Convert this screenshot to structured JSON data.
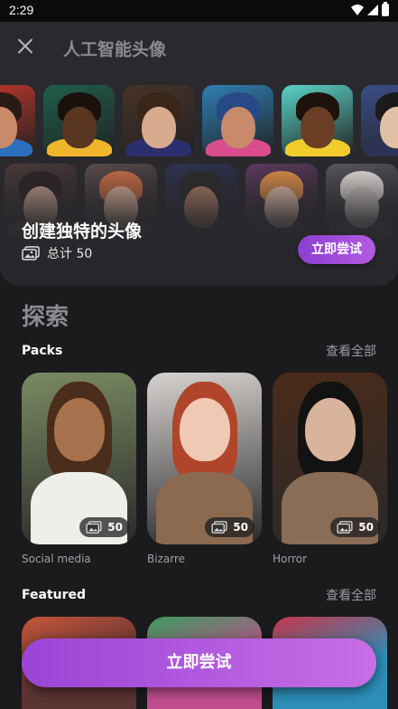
{
  "status_bar": {
    "time": "2:29"
  },
  "header": {
    "title": "人工智能头像",
    "close_icon": "close-icon"
  },
  "hero": {
    "title": "创建独特的头像",
    "total_text": "总计 50",
    "try_button": "立即尝试",
    "row1": [
      {
        "bg": "#c2372b",
        "skin": "#c98a6a",
        "hair": "#2a1a14",
        "body": "#2d6fbf"
      },
      {
        "bg": "#1f5f4b",
        "skin": "#5a3522",
        "hair": "#1a110c",
        "body": "#f0b52a"
      },
      {
        "bg": "#473327",
        "skin": "#d8ab8f",
        "hair": "#3a2619",
        "body": "#2b2f6e"
      },
      {
        "bg": "#2f7fb4",
        "skin": "#c88a6b",
        "hair": "#274a86",
        "body": "#d94d8f"
      },
      {
        "bg": "#5ad3c7",
        "skin": "#6a3f26",
        "hair": "#1e120c",
        "body": "#f1cd2c"
      },
      {
        "bg": "#3c4e8a",
        "skin": "#e2c0a5",
        "hair": "#1b1b1b",
        "body": "#2d3354"
      }
    ],
    "row2": [
      {
        "bg": "#4b3a3b",
        "skin": "#c9a08a",
        "hair": "#2b2327",
        "body": "#5a4b4d"
      },
      {
        "bg": "#5a4a4c",
        "skin": "#e0b49c",
        "hair": "#c46b43",
        "body": "#3c3a45"
      },
      {
        "bg": "#2f3350",
        "skin": "#b07e63",
        "hair": "#2a2a2a",
        "body": "#2a2a3a"
      },
      {
        "bg": "#5c3a5d",
        "skin": "#e8c3af",
        "hair": "#d78a47",
        "body": "#3b2f48"
      },
      {
        "bg": "#585660",
        "skin": "#cfc6c1",
        "hair": "#dcd6d3",
        "body": "#46444d"
      }
    ]
  },
  "explore": {
    "title": "探索",
    "packs": {
      "title": "Packs",
      "see_all": "查看全部",
      "items": [
        {
          "label": "Social media",
          "count": "50",
          "bg": "#7a8a62",
          "skin": "#a6714c",
          "hair": "#4a2d1a",
          "body": "#eeeeea"
        },
        {
          "label": "Bizarre",
          "count": "50",
          "bg": "#d6d2cf",
          "skin": "#f0c9b4",
          "hair": "#b0452a",
          "body": "#8b6a50"
        },
        {
          "label": "Horror",
          "count": "50",
          "bg": "#4a2b1a",
          "skin": "#d9b49c",
          "hair": "#121212",
          "body": "#8a6d57"
        }
      ]
    },
    "featured": {
      "title": "Featured",
      "see_all": "查看全部",
      "items": [
        {
          "bg": "#5a3433",
          "accent": "#c8553a"
        },
        {
          "bg": "#c24d8e",
          "accent": "#3d9c5e"
        },
        {
          "bg": "#2d8fb8",
          "accent": "#c8354a"
        }
      ]
    }
  },
  "cta": {
    "label": "立即尝试"
  }
}
